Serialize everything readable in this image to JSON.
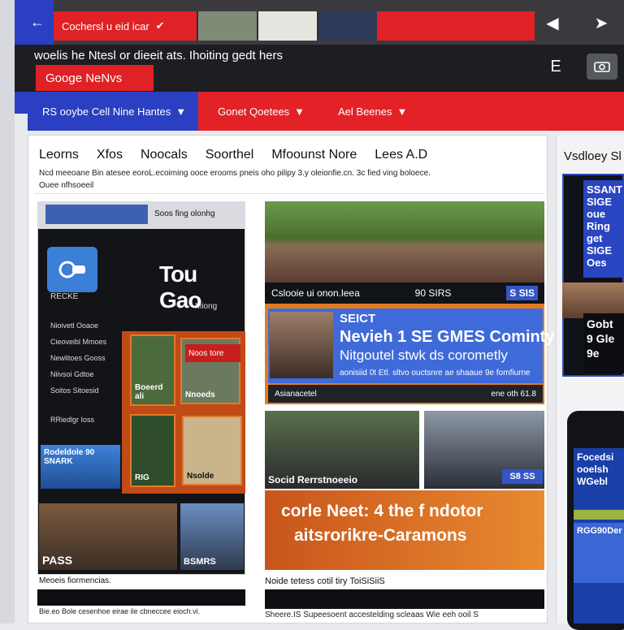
{
  "browser": {
    "tab_title": "Cochersl u eid icar",
    "url_text": "woelis he Ntesl or dieeit ats. Ihoiting gedt hers",
    "app_button": "Googe NeNvs",
    "e_button": "E"
  },
  "filters": {
    "primary": "RS ooybe Cell Nine Hantes",
    "secondary": "Gonet Qoetees",
    "tertiary": "Ael Beenes"
  },
  "categories": [
    "Leorns",
    "Xfos",
    "Noocals",
    "Soorthel",
    "Mfoounst Nore",
    "Lees A.D"
  ],
  "subnav": {
    "line1": "Ncd meeoane   Bin atesee   eoroL.ecoiming   ooce erooms   pneis oho pilipy 3.y   oleionfie.cn. 3c fied ving boloece.",
    "line2": "Ouee nfhsoeeil"
  },
  "left_card": {
    "top_text": "Soos fing olonhg",
    "headline": "Tou Gao",
    "sub1": "RECKE",
    "sub2": "Miong",
    "items": [
      "Nioivetl Ooaoe",
      "Cieoveibl Mmoes",
      "Newlitoes Gooss",
      "Niivsoi Gdtoe",
      "Soitos Sitoesid",
      "RRiedlgr Ioss"
    ],
    "tab_label": "Noos tore",
    "tile1": "Boeerd ali",
    "tile2": "Nnoeds",
    "tile3": "RIG",
    "tile4": "Nsolde",
    "blue_tile": "Rodeldole 90 SNARK",
    "bottom1": "PASS",
    "bottom2": "BSMRS",
    "caption": "Meoeis fiormencias.",
    "fineprint": "Bie.eo Bole cesenhoe eirae ile cbneccee eioch.vi."
  },
  "center": {
    "cap1_left": "Cslooie ui onon.leea",
    "cap1_right": "90 SIRS",
    "cap1_tag": "S SIS",
    "blue_title1": "SEICT",
    "blue_title2": "Nevieh 1 SE GMES Cominty",
    "blue_title3": "Nitgoutel stwk ds corometly",
    "blue_sub": "aonisiid 0t Etl. sltvo ouctsnre ae shaaue 9e fomfiurne",
    "bar_left": "Asianacetel",
    "bar_right": "ene oth 61.8",
    "photo2_label": "Socid Rerrstnoeeio",
    "photo3_tag": "S8 SS",
    "orange_title1": "corle Neet: 4 the f ndotor",
    "orange_title2": "aitsrorikre-Caramons",
    "caption": "Noide tetess cotil tiry ToiSiSiiS",
    "fineprint": "Sheere.IS Supeesoent accestelding scleaas Wie eeh ooil S"
  },
  "right": {
    "title": "Vsdloey Sl",
    "blue_box": "SSANT SIGE oue Ring get SIGE Oes",
    "dark_box": "Gobt 9 Gle 9e",
    "phone_text": "Focedsi ooelsh WGebl",
    "phone_tile": "RGG90Der"
  },
  "colors": {
    "red": "#e02125",
    "blue": "#2a3fc1",
    "orange": "#e07b24",
    "dark": "#1e1e22"
  }
}
